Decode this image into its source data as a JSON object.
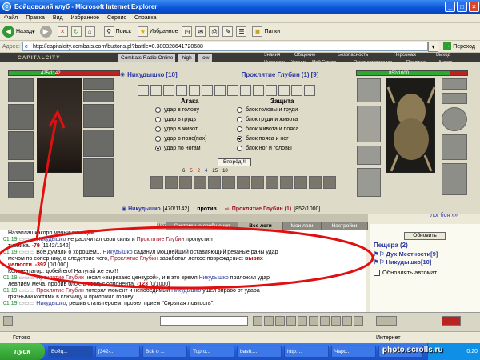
{
  "window": {
    "title": "Бойцовский клуб - Microsoft Internet Explorer"
  },
  "menu": [
    "Файл",
    "Правка",
    "Вид",
    "Избранное",
    "Сервис",
    "Справка"
  ],
  "toolbar": {
    "back": "Назад",
    "search": "Поиск",
    "favorites": "Избранное",
    "folders": "Папки"
  },
  "address": {
    "label": "Адрес:",
    "url": "http://capitalcity.combats.com/buttons.pl?battle=0.380328641720688",
    "go": "Переход"
  },
  "game_nav": {
    "logo": "CAPITALCITY",
    "radio": "Combats Radio Online",
    "high": "high",
    "low": "low",
    "links_top": [
      "Знания",
      "Общение",
      "Безопасность",
      "Персонаж",
      "Выход"
    ],
    "links_bottom": [
      "Инвентарь",
      "Умения",
      "Мой Скрипт",
      "Отчет о переводах",
      "Поединки",
      "Анкета"
    ]
  },
  "left_fighter": {
    "name": "Никудышко",
    "level": "[10]",
    "hp": "475/1142",
    "hp_fraction": 0.42
  },
  "right_fighter": {
    "name": "Проклятие Глубин",
    "count": "(1)",
    "level": "[9]",
    "hp": "852/1000",
    "hp_fraction": 0.85
  },
  "combat": {
    "attack_title": "Атака",
    "defense_title": "Защита",
    "attacks": [
      "удар в голову",
      "удар в грудь",
      "удар в живот",
      "удар в пояс(пах)",
      "удар по ногам"
    ],
    "attack_selected": 4,
    "defenses": [
      "блок головы и груди",
      "блок груди и живота",
      "блок живота и пояса",
      "блок пояса и ног",
      "блок ног и головы"
    ],
    "defense_selected": 3,
    "go_button": "Вперёд!!!",
    "stats": [
      "6",
      "5",
      "2",
      "4",
      "25",
      "10"
    ]
  },
  "vs": {
    "left": "Никудышко",
    "left_hp": "[470/1142]",
    "word": "против",
    "right": "Проклятие Глубин (1)",
    "right_hp": "[852/1000]",
    "log_label": "лог боя »»"
  },
  "tabs": [
    "Чат",
    "Системные сообщения",
    "Все логи",
    "Мои логи",
    "Настройки"
  ],
  "chat": [
    {
      "time": "",
      "parts": [
        {
          "t": "Назаплашкакорп мачнинизниции",
          "c": ""
        }
      ]
    },
    {
      "time": "01:19",
      "parts": [
        {
          "t": "Никудышко",
          "c": "p1"
        },
        {
          "t": " не рассчитал свои силы и ",
          "c": ""
        },
        {
          "t": "Проклятие Глубин",
          "c": "p2"
        },
        {
          "t": " пропустил",
          "c": ""
        }
      ]
    },
    {
      "time": "",
      "parts": [
        {
          "t": "тивника. ",
          "c": ""
        },
        {
          "t": "-79",
          "c": "red"
        },
        {
          "t": " [1142/1142]",
          "c": ""
        }
      ]
    },
    {
      "time": "01:19",
      "parts": [
        {
          "t": "Все думали о хорошем... ",
          "c": ""
        },
        {
          "t": "Никудышко",
          "c": "p1"
        },
        {
          "t": " саданул мощнейший оставляющий резаные раны удар",
          "c": ""
        }
      ]
    },
    {
      "time": "",
      "parts": [
        {
          "t": "мечом по сопернику, в следствие чего, ",
          "c": ""
        },
        {
          "t": "Проклятие Глубин",
          "c": "p2"
        },
        {
          "t": " заработал легкое повреждение: ",
          "c": ""
        },
        {
          "t": "вывих",
          "c": "red"
        }
      ]
    },
    {
      "time": "",
      "parts": [
        {
          "t": "челюсти. -392",
          "c": "red"
        },
        {
          "t": " [0/1000]",
          "c": ""
        }
      ]
    },
    {
      "time": "",
      "parts": [
        {
          "t": "Комментатор: добей его! Напугай же его!!!",
          "c": ""
        }
      ]
    },
    {
      "time": "01:19",
      "parts": [
        {
          "t": "Проклятие Глубин",
          "c": "p2"
        },
        {
          "t": " чесал «вырезано цензурой», и в это время ",
          "c": ""
        },
        {
          "t": "Никудышко",
          "c": "p1"
        },
        {
          "t": " приложил удар",
          "c": ""
        }
      ]
    },
    {
      "time": "",
      "parts": [
        {
          "t": "левпием меча, пробив блок, в корпус оппонента. ",
          "c": ""
        },
        {
          "t": "-123",
          "c": "red"
        },
        {
          "t": " [0/1000]",
          "c": ""
        }
      ]
    },
    {
      "time": "01:19",
      "parts": [
        {
          "t": "Проклятие Глубин",
          "c": "p2"
        },
        {
          "t": " потерял момент и непобедимый ",
          "c": ""
        },
        {
          "t": "Никудышко",
          "c": "p1"
        },
        {
          "t": " ушел вправо от удара",
          "c": ""
        }
      ]
    },
    {
      "time": "",
      "parts": [
        {
          "t": "грязными когтями в ключицу и приложил голову.",
          "c": ""
        }
      ]
    },
    {
      "time": "01:19",
      "parts": [
        {
          "t": "Никудышко",
          "c": "p1"
        },
        {
          "t": ", решив стать героем, провел прием \"Скрытая ловкость\".",
          "c": ""
        }
      ]
    }
  ],
  "side": {
    "refresh": "Обновить",
    "location": "Пещера",
    "location_count": "(2)",
    "users": [
      "Дух Местности[9]",
      "Никудышко[10]"
    ],
    "auto": "Обновлять автомат."
  },
  "statusbar": {
    "left": "Готово",
    "right": "Интернет"
  },
  "taskbar": {
    "start": "пуск",
    "tasks": [
      "Бойц...",
      "[342-...",
      "Всё о ...",
      "Торго...",
      "bash....",
      "http:...",
      "Чарс...",
      "Безым..."
    ],
    "clock": "0:20"
  },
  "watermark": "photo.scrolls.ru",
  "colors": {
    "accent_blue": "#2d39a0",
    "red": "#b30000",
    "green": "#1c8a2f",
    "annotation_red": "#e01010"
  }
}
